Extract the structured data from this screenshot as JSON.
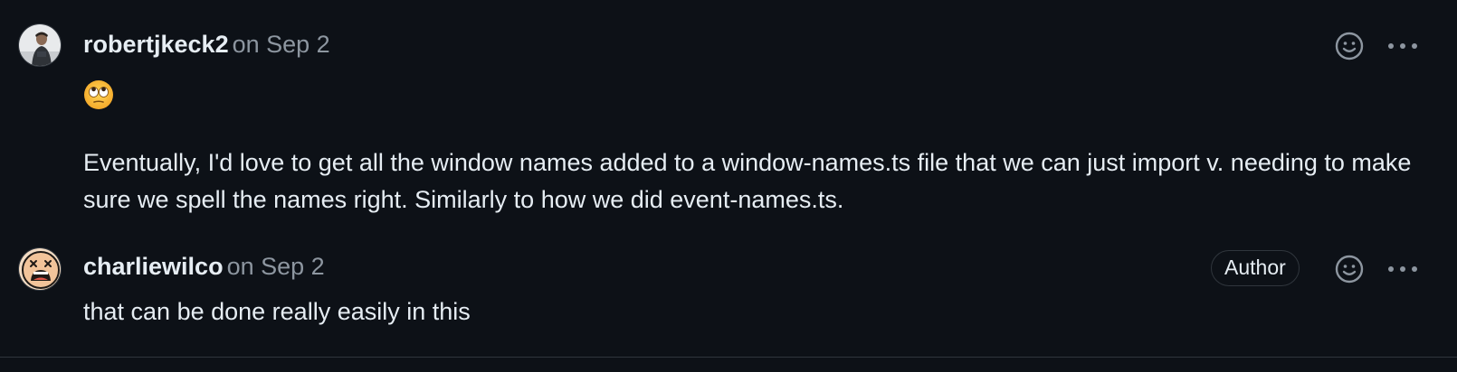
{
  "comments": [
    {
      "author": "robertjkeck2",
      "timestamp": "on Sep 2",
      "emoji_icon": "face-with-rolling-eyes-icon",
      "body": "Eventually, I'd love to get all the window names added to a window-names.ts file that we can just import v. needing to make sure we spell the names right. Similarly to how we did event-names.ts."
    },
    {
      "author": "charliewilco",
      "timestamp": "on Sep 2",
      "badge": "Author",
      "body": "that can be done really easily in this"
    }
  ],
  "icons": {
    "reaction": "smiley-icon",
    "more": "kebab-horizontal-icon"
  },
  "colors": {
    "background": "#0d1117",
    "text": "#e6edf3",
    "muted": "#8d96a0",
    "border": "#30363d"
  }
}
